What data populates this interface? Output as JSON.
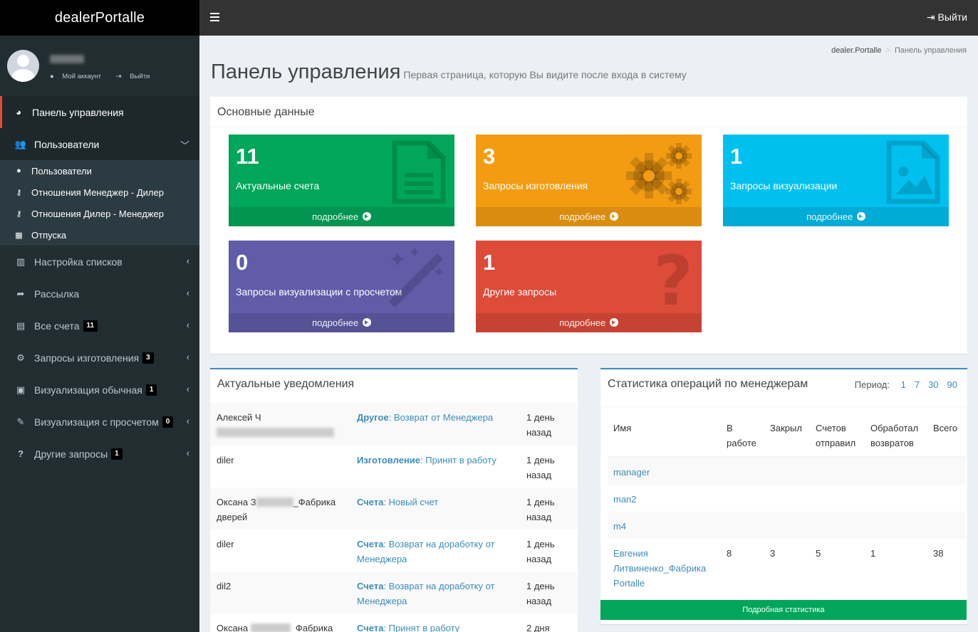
{
  "app": {
    "logo": "dealerPortalle"
  },
  "user": {
    "my_account": "Мой аккаунт",
    "logout": "Выйти"
  },
  "sidebar": {
    "items": [
      {
        "label": "Панель управления",
        "icon": "dashboard-icon",
        "active": true
      },
      {
        "label": "Пользователи",
        "icon": "users-icon",
        "open": true,
        "chevron": "down"
      },
      {
        "label": "Настройка списков",
        "icon": "barcode-icon"
      },
      {
        "label": "Рассылка",
        "icon": "share-icon"
      },
      {
        "label": "Все счета",
        "icon": "file-icon",
        "badge": "11"
      },
      {
        "label": "Запросы изготовления",
        "icon": "gears-icon",
        "badge": "3"
      },
      {
        "label": "Визуализация обычная",
        "icon": "image-icon",
        "badge": "1"
      },
      {
        "label": "Визуализация с просчетом",
        "icon": "magic-icon",
        "badge": "0"
      },
      {
        "label": "Другие запросы",
        "icon": "question-icon",
        "badge": "1"
      }
    ],
    "subitems": [
      {
        "label": "Пользователи",
        "icon": "user-icon"
      },
      {
        "label": "Отношения Менеджер - Дилер",
        "icon": "key-icon"
      },
      {
        "label": "Отношения Дилер - Менеджер",
        "icon": "key-icon"
      },
      {
        "label": "Отпуска",
        "icon": "calendar-icon"
      }
    ]
  },
  "topbar": {
    "logout": "Выйти"
  },
  "breadcrumb": {
    "home": "dealer.Portalle",
    "current": "Панель управления"
  },
  "page": {
    "title": "Панель управления",
    "subtitle": "Первая страница, которую Вы видите после входа в систему"
  },
  "main_box": {
    "title": "Основные данные",
    "more": "подробнее"
  },
  "stat_boxes": [
    {
      "number": "11",
      "label": "Актуальные счета",
      "color": "#00a65a",
      "icon": "file-text-icon"
    },
    {
      "number": "3",
      "label": "Запросы изготовления",
      "color": "#f39c12",
      "icon": "gears-icon"
    },
    {
      "number": "1",
      "label": "Запросы визуализации",
      "color": "#00c0ef",
      "icon": "file-image-icon"
    },
    {
      "number": "0",
      "label": "Запросы визуализации с просчетом",
      "color": "#605ca8",
      "icon": "magic-icon"
    },
    {
      "number": "1",
      "label": "Другие запросы",
      "color": "#dd4b39",
      "icon": "question-icon"
    }
  ],
  "notifications": {
    "title": "Актуальные уведомления",
    "rows": [
      {
        "user": "Алексей Ч",
        "type": "Другое",
        "text": ": Возврат от Менеджера",
        "time": "1 день назад"
      },
      {
        "user": "diler",
        "type": "Изготовление",
        "text": ": Принят в работу",
        "time": "1 день назад"
      },
      {
        "user_a": "Оксана З",
        "user_b": "_Фабрика дверей",
        "type": "Счета",
        "text": ": Новый счет",
        "time": "1 день назад"
      },
      {
        "user": "diler",
        "type": "Счета",
        "text": ": Возврат на доработку от Менеджера",
        "time": "1 день назад"
      },
      {
        "user": "dil2",
        "type": "Счета",
        "text": ": Возврат на доработку от Менеджера",
        "time": "1 день назад"
      },
      {
        "user_a": "Оксана ",
        "user_b": "_Фабрика",
        "type": "Счета",
        "text": ": Принят в работу",
        "time": "2 дня"
      }
    ]
  },
  "stats": {
    "title": "Статистика операций по менеджерам",
    "period_label": "Период:",
    "periods": [
      "1",
      "7",
      "30",
      "90"
    ],
    "columns": [
      "Имя",
      "В работе",
      "Закрыл",
      "Счетов отправил",
      "Обработал возвратов",
      "Всего"
    ],
    "rows": [
      {
        "name": "manager"
      },
      {
        "name": "man2"
      },
      {
        "name": "m4"
      },
      {
        "name": "Евгения Литвиненко_Фабрика Portalle",
        "in_work": "8",
        "closed": "3",
        "sent": "5",
        "returns": "1",
        "total": "38"
      }
    ],
    "button": "Подробная статистика"
  }
}
